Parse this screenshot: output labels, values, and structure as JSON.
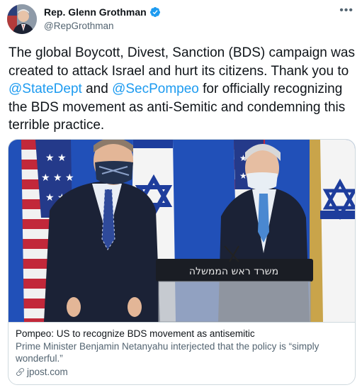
{
  "author": {
    "name": "Rep. Glenn Grothman",
    "handle": "@RepGrothman"
  },
  "more_label": "•••",
  "tweet": {
    "t1": "The global Boycott, Divest, Sanction (BDS) campaign was created to attack Israel and hurt its citizens. Thank you to ",
    "mention1": "@StateDept",
    "t2": " and ",
    "mention2": "@SecPompeo",
    "t3": " for officially recognizing the BDS movement as anti-Semitic and condemning this terrible practice."
  },
  "card": {
    "podium_text": "משרד ראש הממשלה",
    "title": "Pompeo: US to recognize BDS movement as antisemitic",
    "description": "Prime Minister Benjamin Netanyahu interjected that the policy is “simply wonderful.”",
    "domain": "jpost.com"
  },
  "icons": {
    "verified": "verified-badge-icon",
    "link": "link-icon",
    "more": "more-options-icon"
  },
  "colors": {
    "accent": "#1d9bf0",
    "text": "#0f1419",
    "secondary": "#536471",
    "border": "#cfd9de",
    "israel_blue": "#1e3d9c",
    "backdrop_blue": "#1f4db5"
  }
}
